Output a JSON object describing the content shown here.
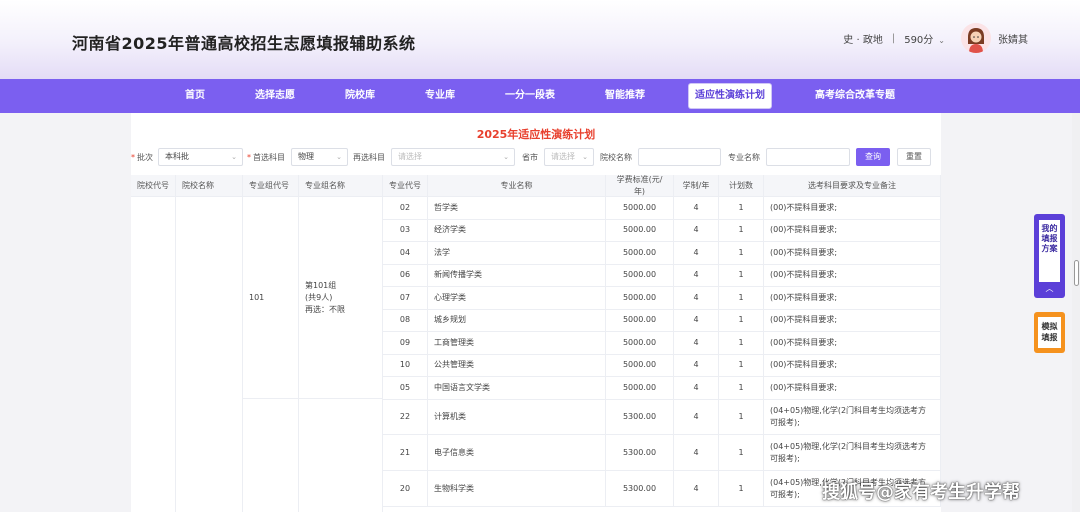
{
  "header": {
    "title": "河南省2025年普通高校招生志愿填报辅助系统",
    "subjects": "史 · 政地",
    "separator": "|",
    "score": "590分",
    "score_caret": "⌄",
    "username": "张婧其"
  },
  "nav": {
    "items": [
      "首页",
      "选择志愿",
      "院校库",
      "专业库",
      "一分一段表",
      "智能推荐",
      "适应性演练计划",
      "高考综合改革专题"
    ],
    "active_index": 6
  },
  "plan_title": "2025年适应性演练计划",
  "filters": {
    "batch_label": "批次",
    "batch_value": "本科批",
    "primary_label": "首选科目",
    "primary_value": "物理",
    "secondary_label": "再选科目",
    "secondary_placeholder": "请选择",
    "province_label": "省市",
    "province_placeholder": "请选择",
    "school_label": "院校名称",
    "school_value": "",
    "major_label": "专业名称",
    "major_value": "",
    "query_button": "查询",
    "reset_button": "重置",
    "required_mark": "*",
    "arrow": "⌄"
  },
  "table": {
    "headers": [
      "院校代号",
      "院校名称",
      "专业组代号",
      "专业组名称",
      "专业代号",
      "专业名称",
      "学费标准(元/年)",
      "学制/年",
      "计划数",
      "选考科目要求及专业备注"
    ],
    "group1": {
      "group_code": "101",
      "group_name_line1": "第101组",
      "group_name_line2": "(共9人)",
      "group_name_line3": "再选：不限",
      "rows": [
        {
          "code": "02",
          "name": "哲学类",
          "fee": "5000.00",
          "years": "4",
          "plan": "1",
          "note": "(00)不提科目要求;"
        },
        {
          "code": "03",
          "name": "经济学类",
          "fee": "5000.00",
          "years": "4",
          "plan": "1",
          "note": "(00)不提科目要求;"
        },
        {
          "code": "04",
          "name": "法学",
          "fee": "5000.00",
          "years": "4",
          "plan": "1",
          "note": "(00)不提科目要求;"
        },
        {
          "code": "06",
          "name": "新闻传播学类",
          "fee": "5000.00",
          "years": "4",
          "plan": "1",
          "note": "(00)不提科目要求;"
        },
        {
          "code": "07",
          "name": "心理学类",
          "fee": "5000.00",
          "years": "4",
          "plan": "1",
          "note": "(00)不提科目要求;"
        },
        {
          "code": "08",
          "name": "城乡规划",
          "fee": "5000.00",
          "years": "4",
          "plan": "1",
          "note": "(00)不提科目要求;"
        },
        {
          "code": "09",
          "name": "工商管理类",
          "fee": "5000.00",
          "years": "4",
          "plan": "1",
          "note": "(00)不提科目要求;"
        },
        {
          "code": "10",
          "name": "公共管理类",
          "fee": "5000.00",
          "years": "4",
          "plan": "1",
          "note": "(00)不提科目要求;"
        },
        {
          "code": "05",
          "name": "中国语言文学类",
          "fee": "5000.00",
          "years": "4",
          "plan": "1",
          "note": "(00)不提科目要求;"
        }
      ]
    },
    "group2": {
      "rows": [
        {
          "code": "22",
          "name": "计算机类",
          "fee": "5300.00",
          "years": "4",
          "plan": "1",
          "note": "(04+05)物理,化学(2门科目考生均须选考方可报考);"
        },
        {
          "code": "21",
          "name": "电子信息类",
          "fee": "5300.00",
          "years": "4",
          "plan": "1",
          "note": "(04+05)物理,化学(2门科目考生均须选考方可报考);"
        },
        {
          "code": "20",
          "name": "生物科学类",
          "fee": "5300.00",
          "years": "4",
          "plan": "1",
          "note": "(04+05)物理,化学(2门科目考生均须选考方可报考);"
        }
      ]
    }
  },
  "float": {
    "my_plan": "我的填报方案",
    "my_plan_arrow": "︿",
    "simulate": "模拟填报"
  },
  "watermark": "搜狐号@家有考生升学帮",
  "colors": {
    "accent": "#7b5ff0",
    "title_red": "#e8402e",
    "sim_orange": "#f5921e"
  }
}
